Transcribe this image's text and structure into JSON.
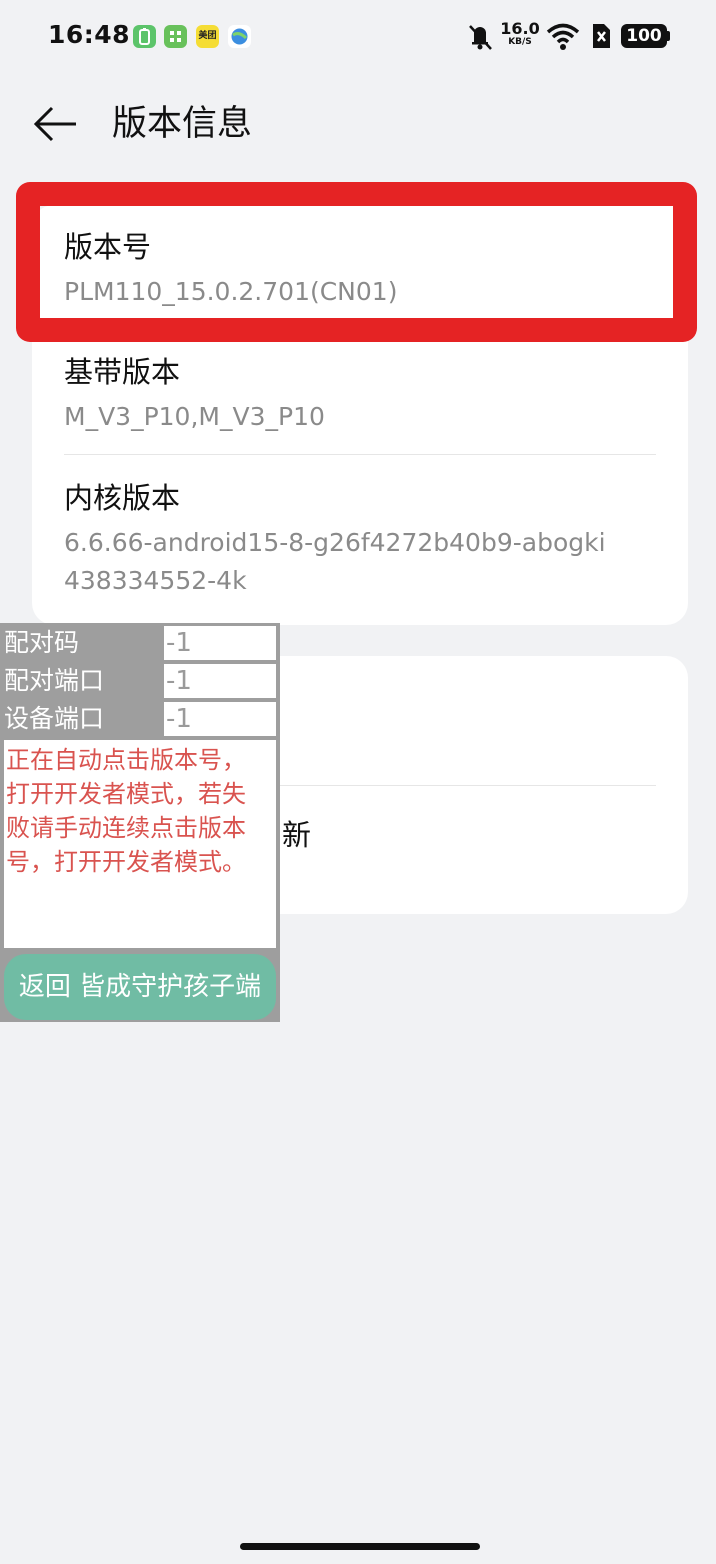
{
  "status_bar": {
    "time": "16:48",
    "speed_value": "16.0",
    "speed_unit": "KB/S",
    "battery": "100",
    "app_icons": [
      "battery-app-icon",
      "grid-app-icon",
      "meituan-app-icon",
      "browser-app-icon"
    ],
    "meituan_label": "美团"
  },
  "header": {
    "title": "版本信息"
  },
  "card1": {
    "items": [
      {
        "label": "版本号",
        "value": "PLM110_15.0.2.701(CN01)"
      },
      {
        "label": "基带版本",
        "value": "M_V3_P10,M_V3_P10"
      },
      {
        "label": "内核版本",
        "value_line1": "6.6.66-android15-8-g26f4272b40b9-abogki",
        "value_line2": "438334552-4k"
      }
    ]
  },
  "card2": {
    "visible_fragment": "新"
  },
  "overlay": {
    "fields": [
      {
        "label": "配对码",
        "value": "-1"
      },
      {
        "label": "配对端口",
        "value": "-1"
      },
      {
        "label": "设备端口",
        "value": "-1"
      }
    ],
    "message_line1": "正在自动点击版本号，",
    "message_line2": "打开开发者模式，若失",
    "message_line3": "败请手动连续点击版本",
    "message_line4": "号，打开开发者模式。",
    "button_label": "返回 皆成守护孩子端"
  },
  "colors": {
    "highlight": "#e52324",
    "panel_bg": "#9e9e9e",
    "message_text": "#d9534f",
    "button_bg": "#70bca4"
  }
}
